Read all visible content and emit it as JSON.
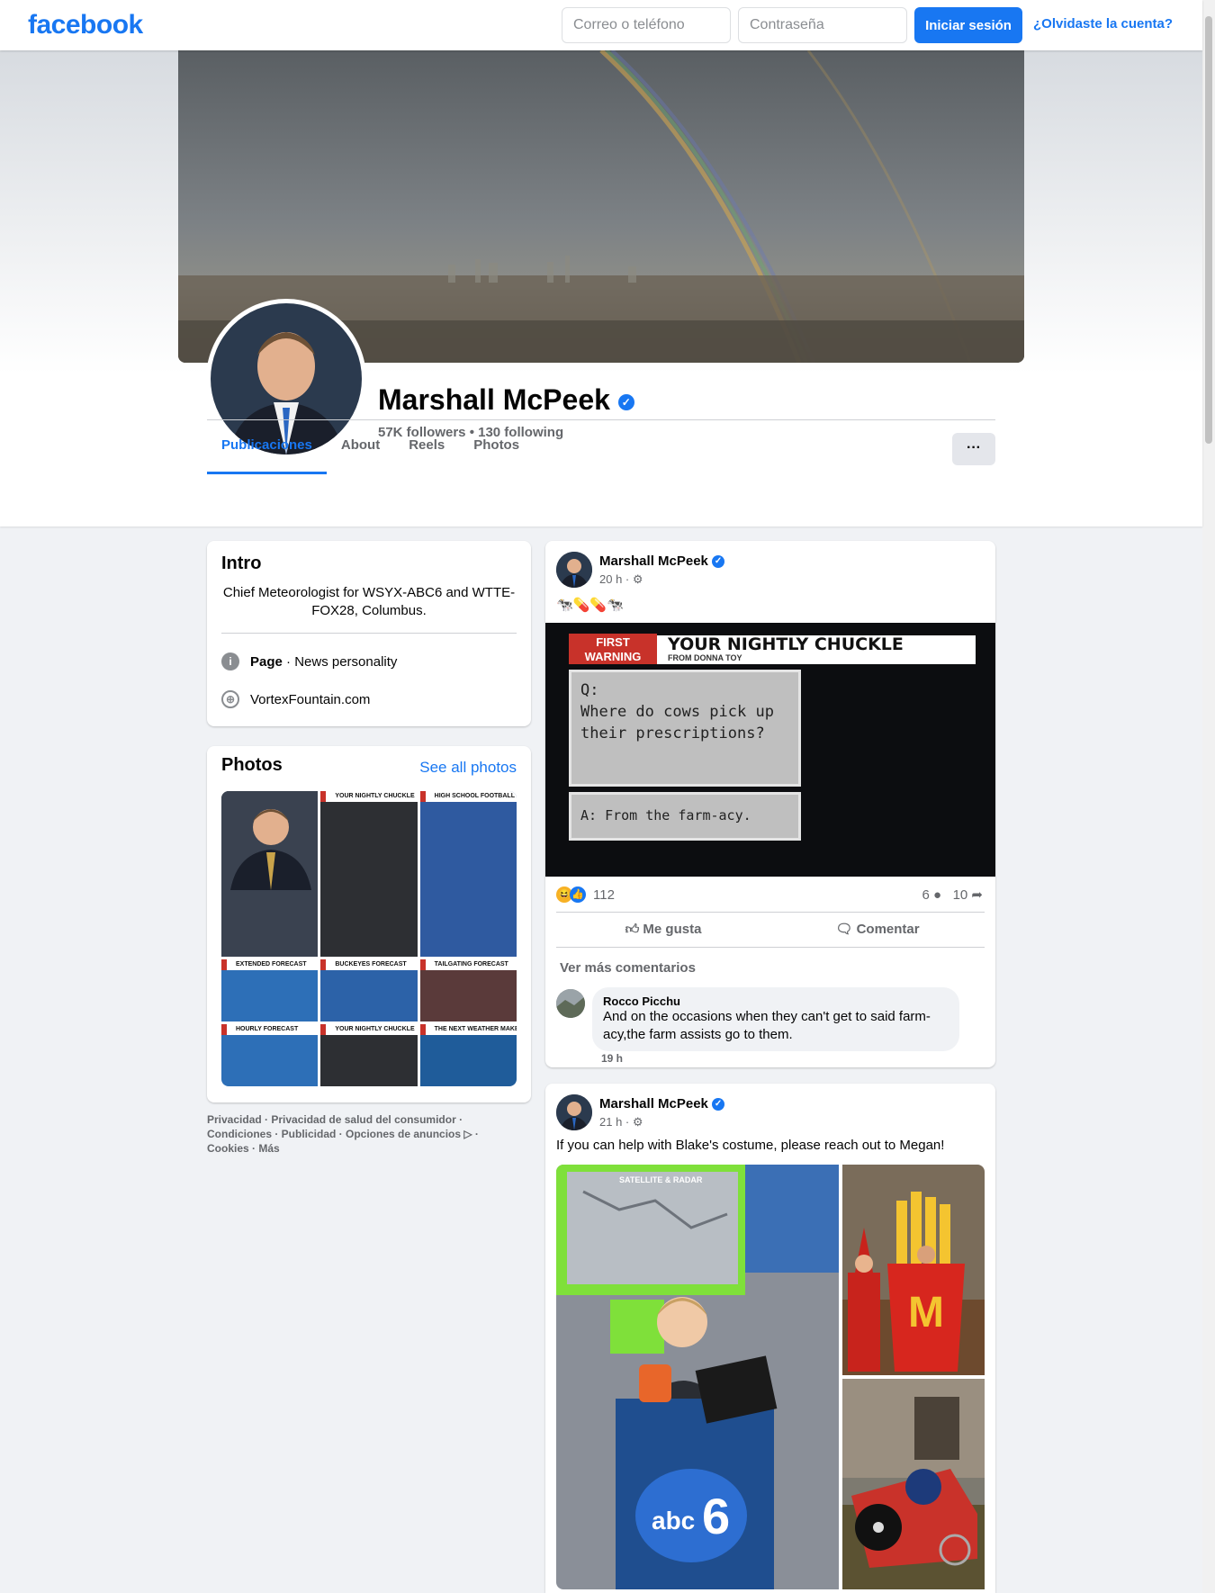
{
  "topbar": {
    "logo": "facebook",
    "email_placeholder": "Correo o teléfono",
    "password_placeholder": "Contraseña",
    "login_label": "Iniciar sesión",
    "forgot_label": "¿Olvidaste la cuenta?"
  },
  "profile": {
    "name": "Marshall McPeek",
    "followers": "57K followers • 130 following",
    "tabs": [
      "Publicaciones",
      "About",
      "Reels",
      "Photos"
    ],
    "more": "···"
  },
  "intro": {
    "title": "Intro",
    "bio": "Chief Meteorologist for WSYX-ABC6 and WTTE-FOX28, Columbus.",
    "page_label": "Page",
    "page_category": " · News personality",
    "website": "VortexFountain.com"
  },
  "photos": {
    "title": "Photos",
    "see_all": "See all photos",
    "thumbs": [
      {
        "caption": "",
        "bg": "#3a4250"
      },
      {
        "caption": "YOUR NIGHTLY CHUCKLE",
        "bg": "#2d2f33"
      },
      {
        "caption": "HIGH SCHOOL FOOTBALL",
        "bg": "#2f5aa0"
      },
      {
        "caption": "EXTENDED FORECAST",
        "bg": "#2d6fb7"
      },
      {
        "caption": "BUCKEYES FORECAST",
        "bg": "#2c62a8"
      },
      {
        "caption": "TAILGATING FORECAST",
        "bg": "#5a3a3a"
      },
      {
        "caption": "HOURLY FORECAST",
        "bg": "#2d6fb7"
      },
      {
        "caption": "YOUR NIGHTLY CHUCKLE",
        "bg": "#2d2f33"
      },
      {
        "caption": "THE NEXT WEATHER MAKE",
        "bg": "#1f5c9a"
      }
    ]
  },
  "footer": {
    "links": "Privacidad · Privacidad de salud del consumidor · Condiciones · Publicidad · Opciones de anuncios ▷ · Cookies · Más"
  },
  "post1": {
    "author": "Marshall McPeek",
    "time": "20 h · ⚙",
    "text": "🐄💊💊🐄",
    "chuckle_header": "FIRST WARNING",
    "chuckle_title": "YOUR NIGHTLY CHUCKLE",
    "chuckle_sub": "FROM DONNA TOY",
    "question": "Q:\nWhere do cows pick up their prescriptions?",
    "answer": "A: From the farm-acy.",
    "reactions": "112",
    "comments_count": "6",
    "shares_count": "10",
    "like_label": "Me gusta",
    "comment_label": "Comentar",
    "more_comments": "Ver más comentarios",
    "comment_author": "Rocco Picchu",
    "comment_text": "And on the occasions when they can't get to said farm-acy,the farm assists go to them.",
    "comment_time": "19 h"
  },
  "post2": {
    "author": "Marshall McPeek",
    "time": "21 h · ⚙",
    "text": "If you can help with Blake's costume, please reach out to Megan!",
    "screen_label": "SATELLITE & RADAR"
  },
  "colors": {
    "brand": "#1877f2",
    "bg": "#f0f2f5"
  }
}
